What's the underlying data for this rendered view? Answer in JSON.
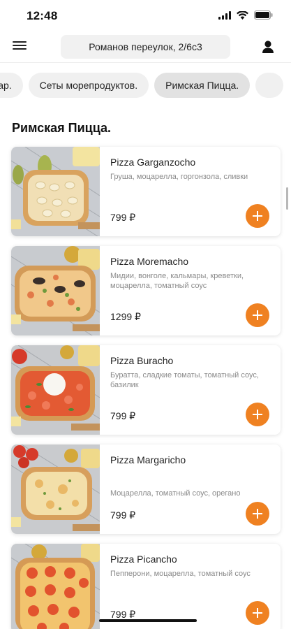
{
  "status_bar": {
    "time": "12:48"
  },
  "header": {
    "address": "Романов переулок, 2/6с3"
  },
  "categories": [
    {
      "label": "Бар."
    },
    {
      "label": "Сеты морепродуктов."
    },
    {
      "label": "Римская Пицца."
    },
    {
      "label": ""
    }
  ],
  "section": {
    "title": "Римская Пицца."
  },
  "products": [
    {
      "name": "Pizza Garganzocho",
      "description": "Груша, моцарелла, горгонзола, сливки",
      "price": "799 ₽"
    },
    {
      "name": "Pizza Moremacho",
      "description": "Мидии, вонголе, кальмары, креветки, моцарелла, томатный соус",
      "price": "1299 ₽"
    },
    {
      "name": "Pizza Buracho",
      "description": "Буратта, сладкие томаты, томатный соус, базилик",
      "price": "799 ₽"
    },
    {
      "name": "Pizza Margaricho",
      "description": "Моцарелла, томатный соус, орегано",
      "price": "799 ₽"
    },
    {
      "name": "Pizza Picancho",
      "description": "Пепперони, моцарелла, томатный соус",
      "price": "799 ₽"
    }
  ],
  "colors": {
    "accent": "#ef8121",
    "chip_bg": "#f0f0f0",
    "chip_active": "#e2e2e2"
  },
  "icons": [
    "hamburger-menu-icon",
    "profile-icon",
    "plus-icon",
    "wifi-icon",
    "battery-icon",
    "signal-icon"
  ]
}
